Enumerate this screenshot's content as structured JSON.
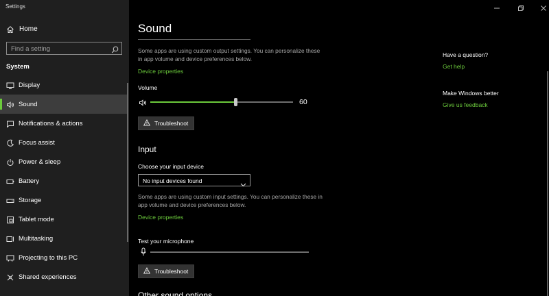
{
  "window": {
    "title": "Settings"
  },
  "sidebar": {
    "home_label": "Home",
    "search_placeholder": "Find a setting",
    "section_label": "System",
    "items": [
      {
        "label": "Display",
        "icon": "display-icon"
      },
      {
        "label": "Sound",
        "icon": "speaker-icon",
        "active": true
      },
      {
        "label": "Notifications & actions",
        "icon": "notifications-icon"
      },
      {
        "label": "Focus assist",
        "icon": "focus-assist-icon"
      },
      {
        "label": "Power & sleep",
        "icon": "power-icon"
      },
      {
        "label": "Battery",
        "icon": "battery-icon"
      },
      {
        "label": "Storage",
        "icon": "storage-icon"
      },
      {
        "label": "Tablet mode",
        "icon": "tablet-mode-icon"
      },
      {
        "label": "Multitasking",
        "icon": "multitasking-icon"
      },
      {
        "label": "Projecting to this PC",
        "icon": "projecting-icon"
      },
      {
        "label": "Shared experiences",
        "icon": "shared-experiences-icon"
      }
    ]
  },
  "main": {
    "title": "Sound",
    "output_desc": "Some apps are using custom output settings. You can personalize these in app volume and device preferences below.",
    "output_device_properties": "Device properties",
    "volume_label": "Volume",
    "volume_value": "60",
    "volume_level": 0.6,
    "troubleshoot_label": "Troubleshoot",
    "input_heading": "Input",
    "input_device_label": "Choose your input device",
    "input_device_value": "No input devices found",
    "input_desc": "Some apps are using custom input settings. You can personalize these in app volume and device preferences below.",
    "input_device_properties": "Device properties",
    "mic_label": "Test your microphone",
    "mic_troubleshoot_label": "Troubleshoot",
    "next_heading": "Other sound options"
  },
  "right": {
    "question": "Have a question?",
    "help_link": "Get help",
    "improve": "Make Windows better",
    "feedback_link": "Give us feedback"
  },
  "colors": {
    "accent": "#6ccb3c",
    "sidebar_bg": "#1f1f1f",
    "main_bg": "#000000"
  }
}
